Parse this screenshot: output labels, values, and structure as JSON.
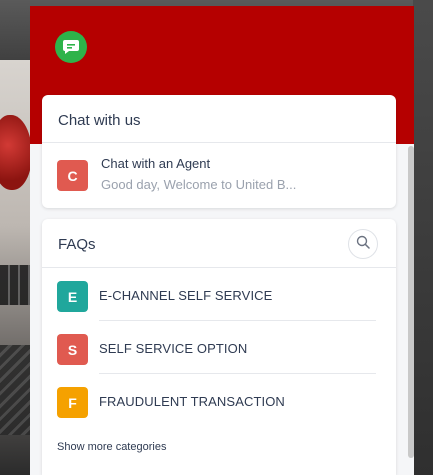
{
  "chat": {
    "title": "Chat with us",
    "conversation": {
      "initial": "C",
      "name": "Chat with an Agent",
      "preview": "Good day, Welcome to United B..."
    }
  },
  "faqs": {
    "title": "FAQs",
    "categories": [
      {
        "initial": "E",
        "label": "E-CHANNEL SELF SERVICE",
        "color": "#20a79c"
      },
      {
        "initial": "S",
        "label": "SELF SERVICE OPTION",
        "color": "#e05a50"
      },
      {
        "initial": "F",
        "label": "FRAUDULENT TRANSACTION",
        "color": "#f5a100"
      }
    ],
    "more_label": "Show more categories"
  },
  "theme": {
    "header_color": "#b50000",
    "logo_color": "#2eb34a"
  },
  "icons": {
    "logo": "chat-bubble-icon",
    "search": "search-icon"
  }
}
